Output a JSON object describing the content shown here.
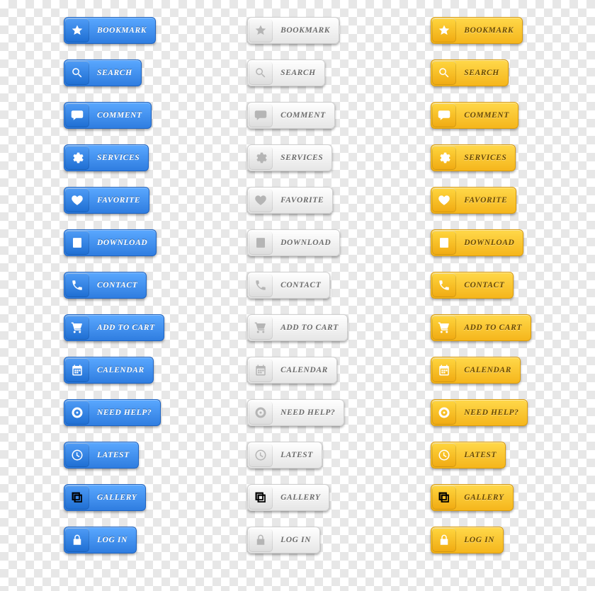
{
  "themes": [
    "blue",
    "grey",
    "gold"
  ],
  "colors": {
    "blue": "#2f7de0",
    "grey": "#e6e6e6",
    "gold": "#f5b61c"
  },
  "buttons": [
    {
      "key": "bookmark",
      "label": "BOOKMARK",
      "icon": "star-icon"
    },
    {
      "key": "search",
      "label": "SEARCH",
      "icon": "search-icon"
    },
    {
      "key": "comment",
      "label": "COMMENT",
      "icon": "speech-bubble-icon"
    },
    {
      "key": "services",
      "label": "SERVICES",
      "icon": "gear-icon"
    },
    {
      "key": "favorite",
      "label": "FAVORITE",
      "icon": "heart-icon"
    },
    {
      "key": "download",
      "label": "DOWNLOAD",
      "icon": "download-icon"
    },
    {
      "key": "contact",
      "label": "CONTACT",
      "icon": "phone-icon"
    },
    {
      "key": "addtocart",
      "label": "ADD TO CART",
      "icon": "cart-icon"
    },
    {
      "key": "calendar",
      "label": "CALENDAR",
      "icon": "calendar-icon"
    },
    {
      "key": "help",
      "label": "NEED HELP?",
      "icon": "lifebuoy-icon"
    },
    {
      "key": "latest",
      "label": "LATEST",
      "icon": "clock-icon"
    },
    {
      "key": "gallery",
      "label": "GALLERY",
      "icon": "gallery-icon"
    },
    {
      "key": "login",
      "label": "LOG IN",
      "icon": "lock-icon"
    }
  ]
}
